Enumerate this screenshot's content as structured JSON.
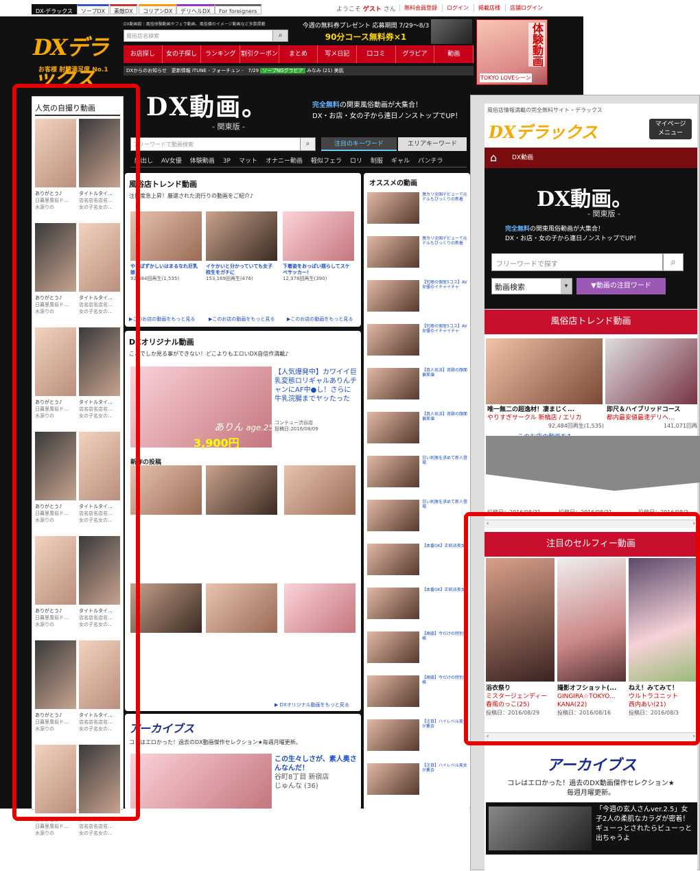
{
  "topnav": {
    "tabs": [
      "DX-デラックス",
      "ソープDX",
      "素敵DX",
      "コリアンDX",
      "デリヘルDX",
      "For foreigners"
    ],
    "welcome_prefix": "ようこそ",
    "welcome_user": "ゲスト",
    "welcome_suffix": "さん",
    "links": [
      "無料会員登録",
      "ログイン",
      "掲載店様",
      "店舗ログイン"
    ]
  },
  "desktop_header": {
    "logo": "DXデラックス",
    "tagline": "お客様 射精満足度 No.1",
    "small_text": "DX動画館｜風俗体験動画やフェラ動画、風俗嬢のイメージ動画など多数掲載",
    "search_placeholder": "風俗店名検索",
    "promo_line1": "今週の無料券プレゼント 応募期間 7/29〜8/3",
    "promo_line2": "90分コース無料券×1",
    "menu": [
      "お店探し",
      "女の子探し",
      "ランキング",
      "割引クーポン",
      "まとめ",
      "写メ日記",
      "口コミ",
      "グラビア",
      "動画"
    ],
    "news_label": "DXからのお知らせ",
    "news_update": "更新情報",
    "news_text": "iTUNE - フォーチュン -",
    "news_date": "7/29",
    "news_tag": "ソープNGグラビア",
    "news_name": "みなみ (21) 美肌",
    "ad_vertical": "体験動画",
    "ad_footer": "TOKYO LOVEシーン"
  },
  "left_sidebar": {
    "title": "人気の自撮り動画",
    "items": [
      {
        "line1": "ありがとう♪",
        "line2": "日暮里風俗ド...",
        "line3": "水源りの"
      },
      {
        "line1": "タイトルタイ...",
        "line2": "店名店名店名...",
        "line3": "女の子名女の..."
      }
    ]
  },
  "main": {
    "title": "DX動画。",
    "region": "- 関東版 -",
    "tagline_bold": "完全無料",
    "tagline_rest": "の関東風俗動画が大集合！",
    "tagline2": "DX・お店・女の子から連日ノンストップでUP！",
    "search_placeholder": "フリーワードで動画検索",
    "tab_keyword": "注目のキーワード",
    "tab_area": "エリアキーワード",
    "categories": [
      "顔出し",
      "AV女優",
      "体験動画",
      "3P",
      "マット",
      "オナニー動画",
      "軽似フェラ",
      "ロリ",
      "制服",
      "ギャル",
      "パンチラ"
    ],
    "trend_title": "風俗店トレンド動画",
    "trend_sub": "注目度急上昇！厳選された流行りの動画をご紹介♪",
    "trend_items": [
      {
        "title": "やっぱずかしいはまるなれ巨乳娘！",
        "views": "92,484回再生(1,535)"
      },
      {
        "title": "イケかいと分かっていても女子校生をガチに",
        "views": "153,169回再生(476)"
      },
      {
        "title": "下着姿をおっぱい揺らしてスケベサッカー！",
        "views": "12,378回再生(390)"
      }
    ],
    "trend_more": "▶このお店の動画をもっと見る",
    "original_title": "DXオリジナル動画",
    "original_sub": "ここでしか見る事ができない！どこよりもエロいDX自信作満載♪",
    "feature_text": "【人気爆発中】カワイイ巨乳変態ロリギャルありんチャンにAF中●し！さらに牛乳浣腸までヤッたった",
    "feature_name": "ありん",
    "feature_age": "age.25",
    "feature_price": "3,900円",
    "feature_shop": "コンテュー渋谷店",
    "feature_date": "投稿日:2016/08/09",
    "posts_title": "新作の投稿",
    "original_more": "▶ DXオリジナル動画をもっと見る",
    "archive_title": "アーカイブス",
    "archive_sub": "コレはエロかった！過去のDX動画傑作セレクション★毎週月曜更新。",
    "archive_item": "この生々しさが、素人奥さんなんだ！",
    "archive_shop": "谷町8丁目 新宿店",
    "archive_name": "じゅんな (36)"
  },
  "recommend": {
    "title": "オススメの動画",
    "items": [
      "激カリ全国デビューで元ドルもびっくりの新着",
      "【究極の個室5コス】AV女優のイチャイチャ",
      "【真人気派】奇跡の顔面偏差値",
      "甘い刺激を求めて新人登場",
      "【本番OK】正統派美女",
      "【高級】今だけの特別価格",
      "【注目】ハイレベル美女が集合"
    ]
  },
  "mobile": {
    "tagline": "風俗店情報満載の完全無料サイト・デラックス",
    "logo": "DXデラックス",
    "menu_line1": "マイページ",
    "menu_line2": "メニュー",
    "breadcrumb": "DX動画",
    "dx_title": "DX動画。",
    "dx_region": "- 関東版 -",
    "dx_tag_bold": "完全無料",
    "dx_tag_rest": "の関東風俗動画が大集合！",
    "dx_tag2": "DX・お店・女の子から連日ノンストップでUP！",
    "search_placeholder": "フリーワードで探す",
    "select_value": "動画検索",
    "chip": "▼動画の注目ワード",
    "trend_section": "風俗店トレンド動画",
    "trend_items": [
      {
        "title": "唯一無二の超逸材！凄まじく...",
        "shop": "やりすぎサークル 新橋店 / エリカ",
        "views": "92,484回再生(1,535)"
      },
      {
        "title": "即尺＆ハイブリッドコース",
        "shop": "都内最安値最速デリヘ...",
        "views": "141,071回再"
      }
    ],
    "trend_more": "このお店の動画をも",
    "hidden_row": [
      {
        "date": "投稿日：2016/08/31"
      },
      {
        "date": "投稿日：2016/08/31"
      },
      {
        "date": "投稿日：2016/08/3"
      }
    ],
    "selfie_section": "注目のセルフィー動画",
    "selfie_items": [
      {
        "title": "浴衣祭り",
        "shop": "ミスタージェンディー",
        "name": "春風のっこ(25)",
        "date": "投稿日：2016/08/29"
      },
      {
        "title": "撮影オフショット(...",
        "shop": "GINGIRA☆TOKYO...",
        "name": "KANA(22)",
        "date": "投稿日：2016/08/16"
      },
      {
        "title": "ねえ！みてみて！",
        "shop": "ウルトラユニット",
        "name": "西内あい(21)",
        "date": "投稿日：2016/08/3"
      }
    ],
    "archive_title": "アーカイブス",
    "archive_sub1": "コレはエロかった！過去のDX動画傑作セレクション★",
    "archive_sub2": "毎週月曜更新。",
    "archive_item": "「今週の玄人さんver.2.5」女子2人の柔肌なカラダが密着！ギューっとされたらビューっと出ちゃうよ"
  },
  "colors": {
    "accent_red": "#c8102e",
    "highlight": "#e60000",
    "brand_gold": "#f6a800",
    "link_blue": "#1a4dc0"
  }
}
